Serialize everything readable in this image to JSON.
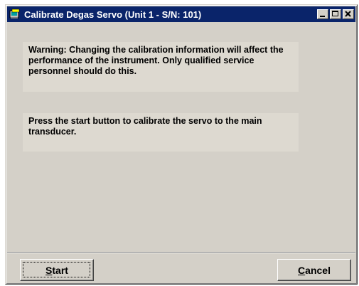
{
  "window": {
    "title": "Calibrate Degas Servo (Unit 1 - S/N: 101)",
    "icon": "app-icon",
    "controls": [
      "minimize",
      "maximize",
      "close"
    ]
  },
  "messages": {
    "warning": "Warning:  Changing the calibration information will affect the performance of the instrument. Only qualified service personnel should do this.",
    "instruction": "Press the start button to calibrate the servo to the main transducer."
  },
  "buttons": {
    "start_label": "Start",
    "cancel_label": "Cancel"
  },
  "colors": {
    "titlebar": "#0a246a",
    "face": "#d4d0c8",
    "panel": "#ddd9d0"
  }
}
